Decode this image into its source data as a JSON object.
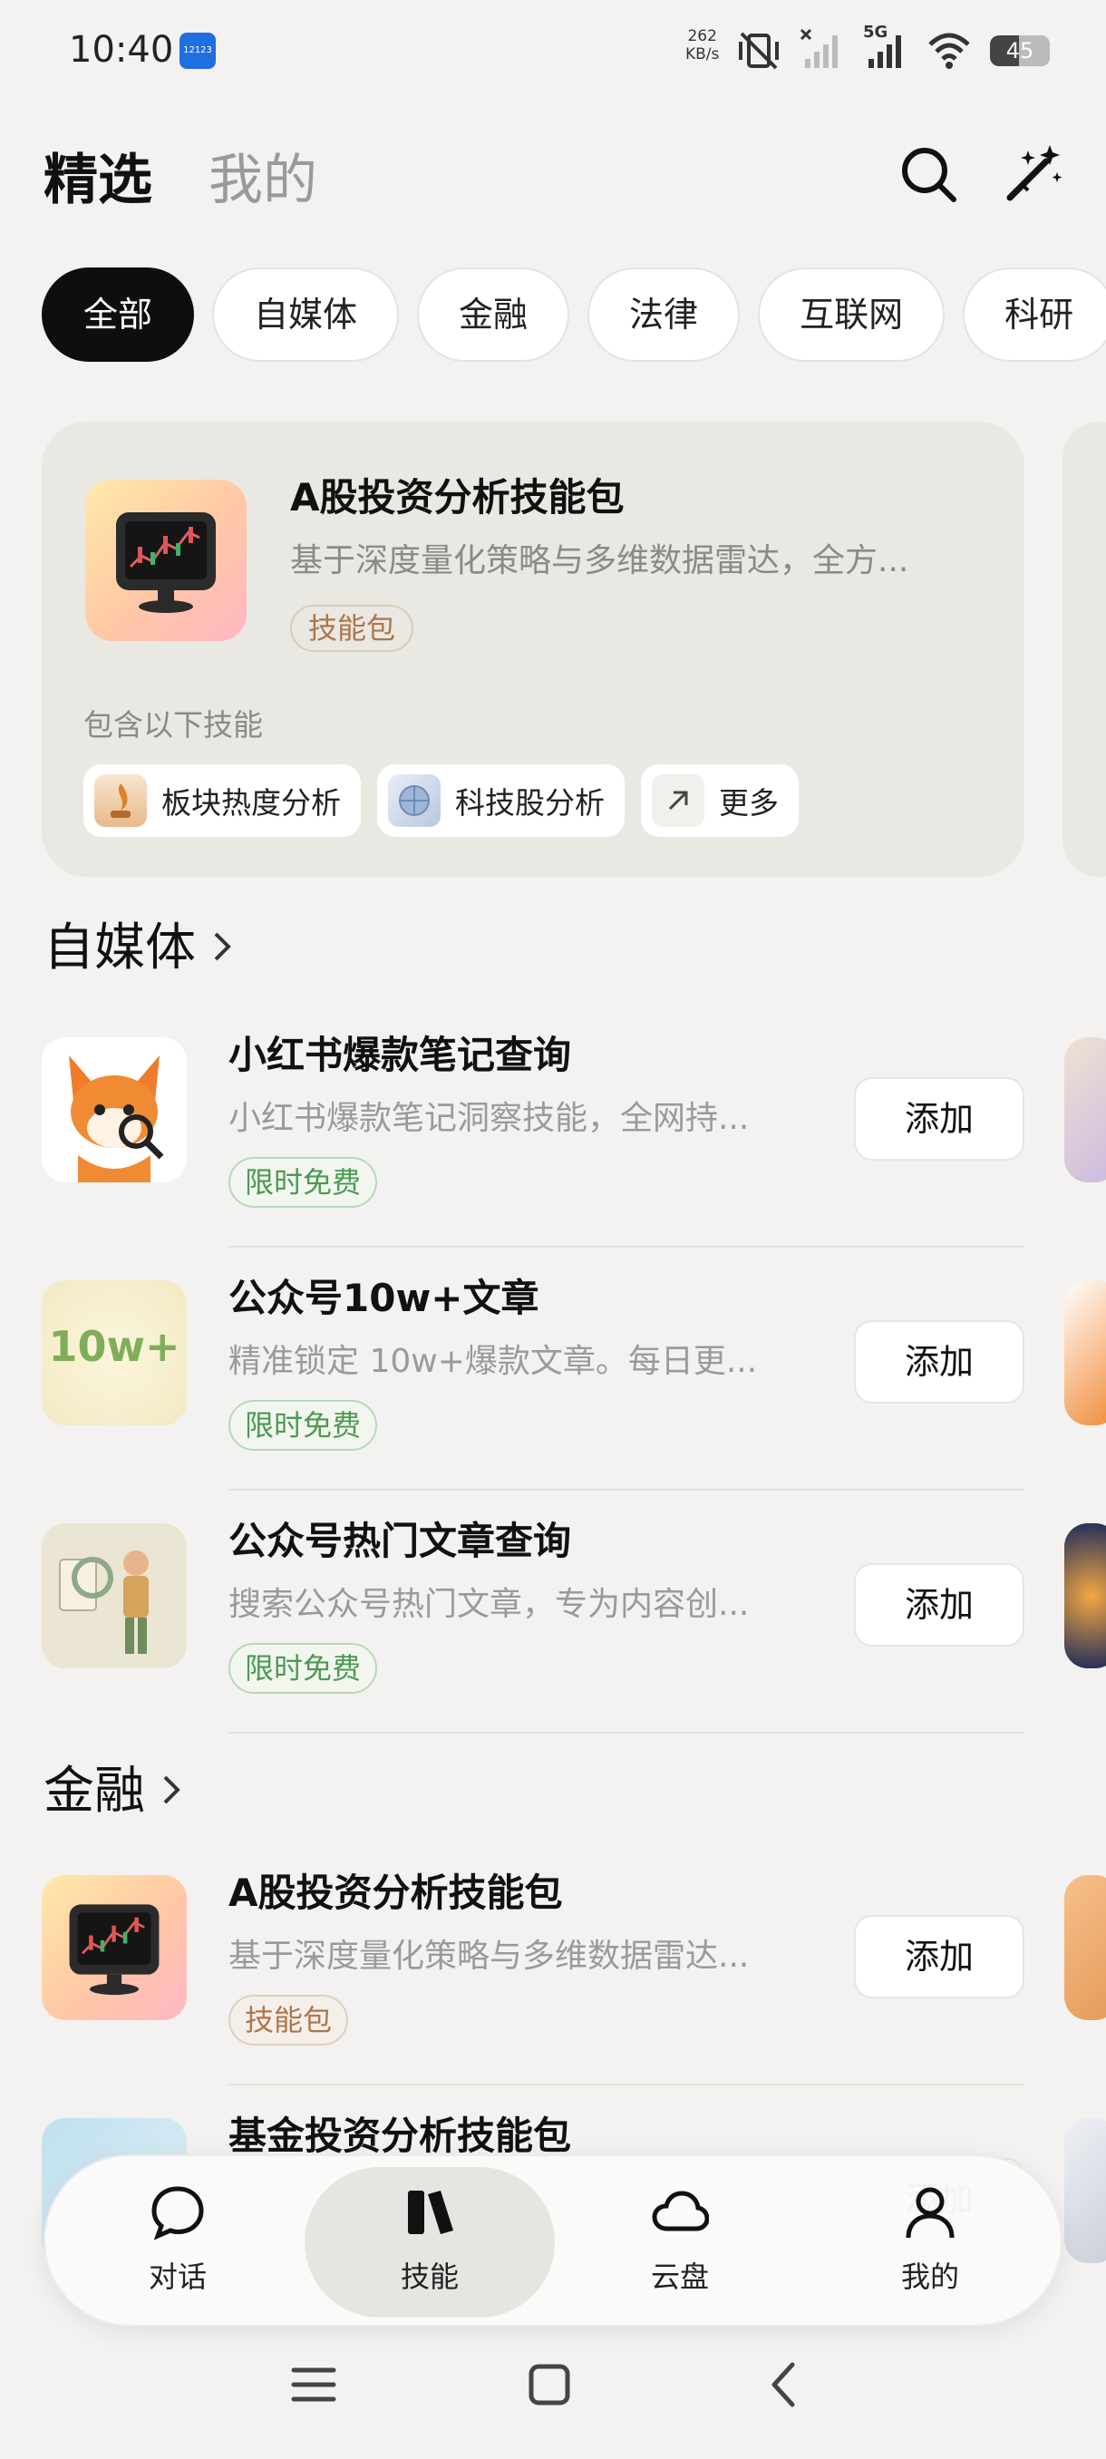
{
  "status_bar": {
    "time": "10:40",
    "app_icon_text": "12123",
    "net_speed_value": "262",
    "net_speed_unit": "KB/s",
    "network": "5G",
    "battery": "45"
  },
  "header": {
    "tab_featured": "精选",
    "tab_mine": "我的",
    "icons": [
      "search-icon",
      "magic-wand-icon"
    ]
  },
  "categories": {
    "selected": "全部",
    "items": [
      "全部",
      "自媒体",
      "金融",
      "法律",
      "互联网",
      "科研"
    ]
  },
  "featured": {
    "title": "A股投资分析技能包",
    "description": "基于深度量化策略与多维数据雷达，全方...",
    "badge": "技能包",
    "includes_label": "包含以下技能",
    "skills": [
      "板块热度分析",
      "科技股分析"
    ],
    "more_label": "更多"
  },
  "sections": [
    {
      "title": "自媒体",
      "items": [
        {
          "title": "小红书爆款笔记查询",
          "description": "小红书爆款笔记洞察技能，全网持...",
          "badge": "限时免费",
          "button": "添加"
        },
        {
          "title": "公众号10w+文章",
          "icon_text": "10w+",
          "description": "精准锁定 10w+爆款文章。每日更...",
          "badge": "限时免费",
          "button": "添加"
        },
        {
          "title": "公众号热门文章查询",
          "description": "搜索公众号热门文章，专为内容创...",
          "badge": "限时免费",
          "button": "添加"
        }
      ]
    },
    {
      "title": "金融",
      "items": [
        {
          "title": "A股投资分析技能包",
          "description": "基于深度量化策略与多维数据雷达...",
          "badge": "技能包",
          "button": "添加"
        },
        {
          "title": "基金投资分析技能包",
          "description": "",
          "badge": "",
          "button": "添加"
        }
      ]
    }
  ],
  "bottom_nav": {
    "active": "技能",
    "items": [
      "对话",
      "技能",
      "云盘",
      "我的"
    ]
  },
  "colors": {
    "background": "#f3f2f0",
    "chip_active": "#0e0e0e",
    "badge_free": "#4a9a52",
    "badge_pack": "#b0754a",
    "muted_text": "#9a9a9a"
  }
}
